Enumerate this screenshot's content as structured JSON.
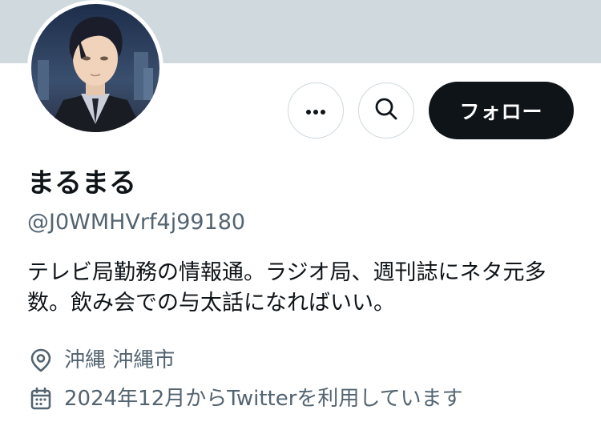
{
  "profile": {
    "display_name": "まるまる",
    "handle": "@J0WMHVrf4j99180",
    "bio": "テレビ局勤務の情報通。ラジオ局、週刊誌にネタ元多数。飲み会での与太話になればいい。",
    "location": "沖縄 沖縄市",
    "joined": "2024年12月からTwitterを利用しています"
  },
  "actions": {
    "more_icon": "more-icon",
    "search_icon": "search-icon",
    "follow_label": "フォロー"
  },
  "icons": {
    "location": "location-pin-icon",
    "joined": "calendar-icon"
  },
  "colors": {
    "banner": "#cfd9de",
    "follow_button": "#0f1419",
    "secondary_text": "#536471"
  }
}
